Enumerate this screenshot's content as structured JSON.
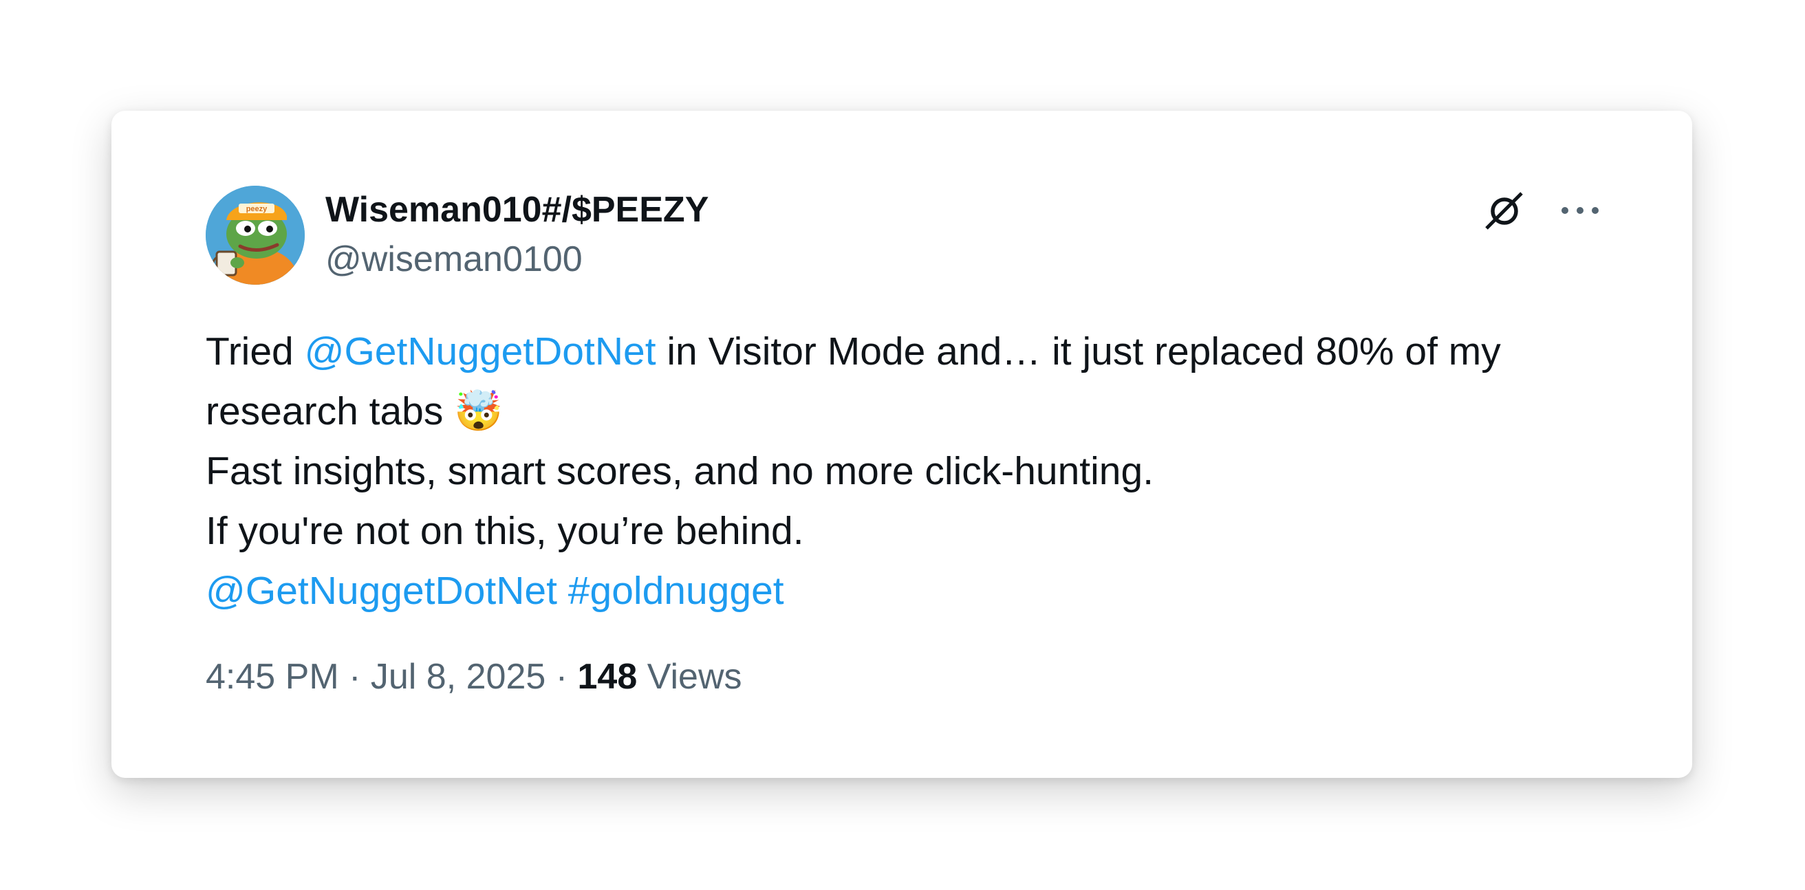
{
  "author": {
    "display_name": "Wiseman010#/$PEEZY",
    "handle": "@wiseman0100",
    "avatar_icon": "pepe-frog-avatar",
    "avatar_cap_text": "peezy"
  },
  "actions": {
    "x_logo_icon": "x-slash-logo-icon",
    "more_icon": "more-horizontal-icon"
  },
  "tweet": {
    "line1_pre": "Tried ",
    "line1_mention": "@GetNuggetDotNet",
    "line1_post": " in Visitor Mode and… it just replaced 80% of my",
    "line2_text": "research tabs ",
    "line2_emoji": "🤯",
    "line3": "Fast insights, smart scores, and no more click-hunting.",
    "line4": "If you're not on this, you’re behind.",
    "line5_mention": "@GetNuggetDotNet",
    "line5_hashtag": "#goldnugget"
  },
  "meta": {
    "time": "4:45 PM",
    "sep1": " · ",
    "date": "Jul 8, 2025",
    "sep2": " · ",
    "views_count": "148",
    "views_label": " Views"
  },
  "colors": {
    "link": "#1d9bf0",
    "text": "#0f1419",
    "secondary": "#536471"
  }
}
